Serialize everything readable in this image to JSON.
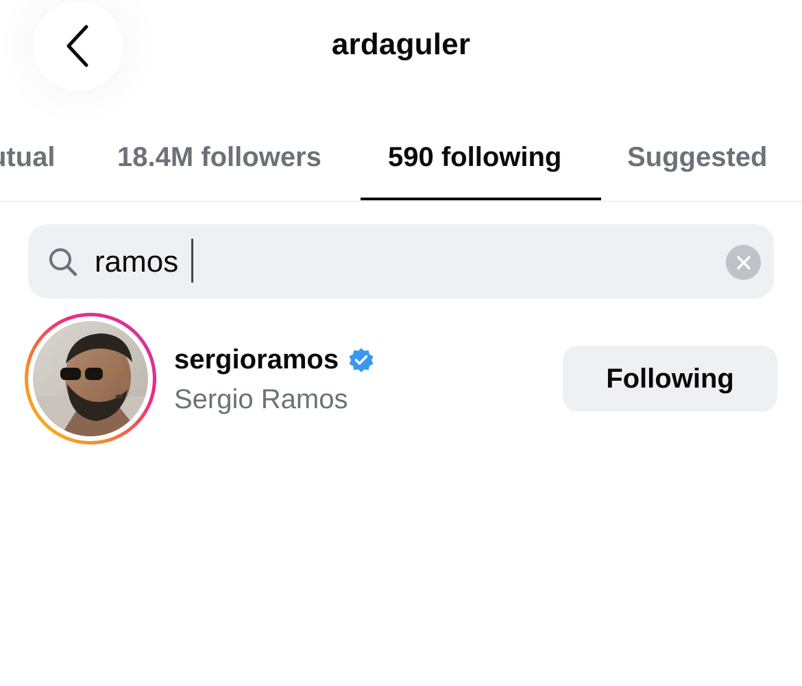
{
  "header": {
    "title": "ardaguler",
    "back_icon": "chevron-left-icon"
  },
  "tabs": [
    {
      "label": "utual",
      "active": false
    },
    {
      "label": "18.4M followers",
      "active": false
    },
    {
      "label": "590 following",
      "active": true
    },
    {
      "label": "Suggested",
      "active": false
    }
  ],
  "search": {
    "value": "ramos",
    "icon": "search-icon",
    "clear_icon": "clear-icon"
  },
  "results": [
    {
      "username": "sergioramos",
      "full_name": "Sergio Ramos",
      "verified": true,
      "has_story": true,
      "button_label": "Following"
    }
  ],
  "colors": {
    "text_primary": "#0a0a0a",
    "text_secondary": "#6c717a",
    "field_background": "#eff0f4",
    "verified_blue": "#3897f0",
    "story_ring": [
      "#f7c323",
      "#f58b2a",
      "#ee2a7b",
      "#c837ab"
    ]
  }
}
